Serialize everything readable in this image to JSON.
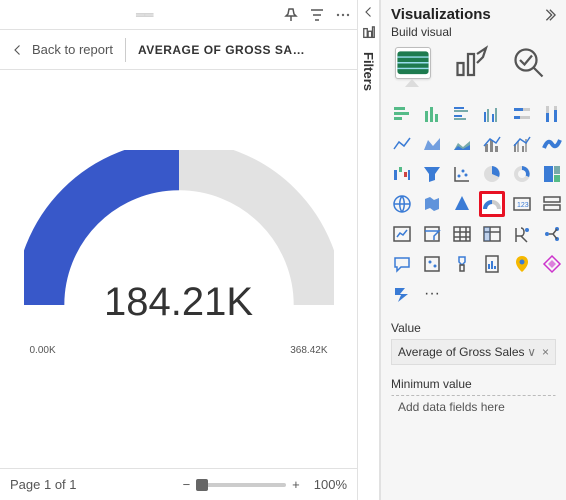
{
  "report": {
    "back_label": "Back to report",
    "title": "AVERAGE OF GROSS SAL…",
    "gauge": {
      "value_label": "184.21K",
      "min_label": "0.00K",
      "max_label": "368.42K"
    },
    "page_label": "Page 1 of 1",
    "zoom": {
      "minus": "−",
      "plus": "+",
      "pct": "100%"
    }
  },
  "filters": {
    "label": "Filters"
  },
  "viz": {
    "header": "Visualizations",
    "sub": "Build visual",
    "tabs": {
      "build": "build-visual",
      "format": "format-visual",
      "analytics": "analytics"
    },
    "value_section": "Value",
    "value_field": "Average of Gross Sales",
    "min_section": "Minimum value",
    "placeholder": "Add data fields here"
  },
  "chart_data": {
    "type": "gauge",
    "value": 184.21,
    "min": 0.0,
    "max": 368.42,
    "unit": "K",
    "title": "AVERAGE OF GROSS SALES",
    "fill_ratio": 0.5
  }
}
